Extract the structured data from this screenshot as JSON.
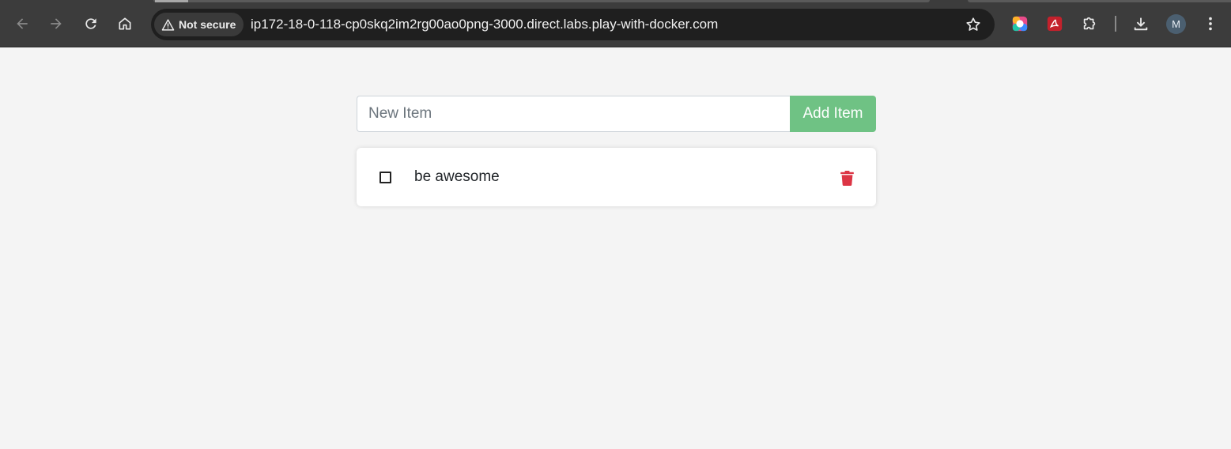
{
  "browser": {
    "security_label": "Not secure",
    "url": "ip172-18-0-118-cp0skq2im2rg00ao0png-3000.direct.labs.play-with-docker.com",
    "profile_initial": "M",
    "icons": [
      "back-icon",
      "forward-icon",
      "reload-icon",
      "home-icon",
      "warning-icon",
      "star-icon",
      "color-picker-extension-icon",
      "pdf-extension-icon",
      "extensions-puzzle-icon",
      "download-icon",
      "more-vert-icon"
    ]
  },
  "todo": {
    "new_item_placeholder": "New Item",
    "add_button_label": "Add Item",
    "items": [
      {
        "name": "be awesome",
        "completed": false
      }
    ]
  },
  "colors": {
    "page_background": "#f4f4f4",
    "add_button": "#6fc284",
    "delete_icon": "#dc3545",
    "chrome_background": "#3c3c3c"
  }
}
